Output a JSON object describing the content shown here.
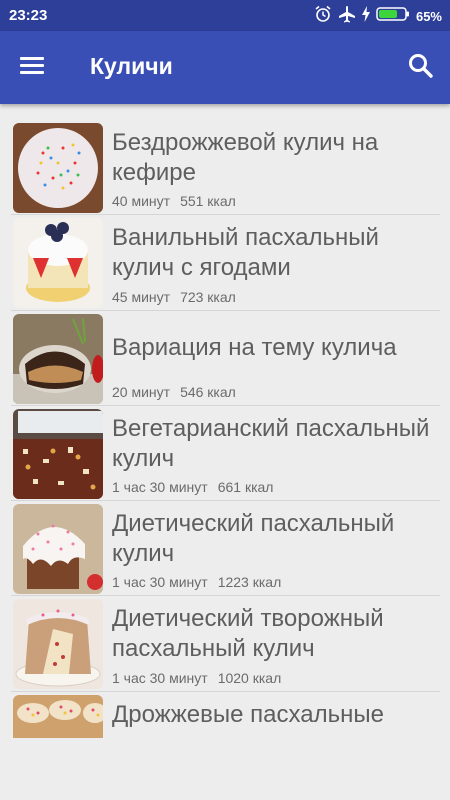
{
  "status": {
    "time": "23:23",
    "battery": "65%"
  },
  "appbar": {
    "title": "Куличи"
  },
  "recipes": [
    {
      "title": "Бездрожжевой кулич на кефире",
      "time": "40 минут",
      "kcal": "551 ккал"
    },
    {
      "title": "Ванильный пасхальный кулич с ягодами",
      "time": "45 минут",
      "kcal": "723 ккал"
    },
    {
      "title": "Вариация на тему кулича",
      "time": "20 минут",
      "kcal": "546 ккал"
    },
    {
      "title": "Вегетарианский пасхальный кулич",
      "time": "1 час 30 минут",
      "kcal": "661 ккал"
    },
    {
      "title": "Диетический пасхальный кулич",
      "time": "1 час 30 минут",
      "kcal": "1223 ккал"
    },
    {
      "title": "Диетический творожный пасхальный кулич",
      "time": "1 час 30 минут",
      "kcal": "1020 ккал"
    },
    {
      "title": "Дрожжевые пасхальные",
      "time": "",
      "kcal": ""
    }
  ]
}
